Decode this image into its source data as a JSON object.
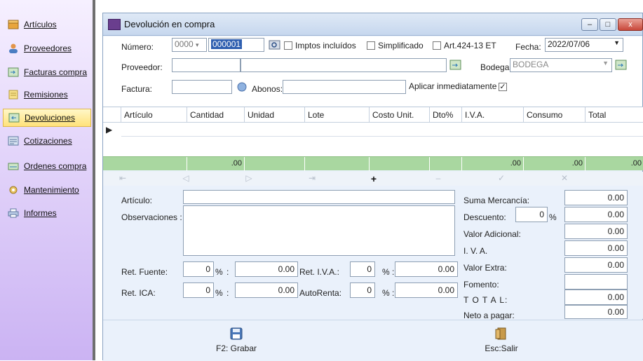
{
  "sidebar": {
    "items": [
      {
        "label": "Artículos",
        "icon": "box-icon"
      },
      {
        "label": "Proveedores",
        "icon": "user-icon"
      },
      {
        "label": "Facturas compra",
        "icon": "invoice-icon"
      },
      {
        "label": "Remisiones",
        "icon": "note-icon"
      },
      {
        "label": "Devoluciones",
        "icon": "return-icon"
      },
      {
        "label": "Cotizaciones",
        "icon": "quote-icon"
      },
      {
        "label": "Ordenes compra",
        "icon": "cart-icon"
      },
      {
        "label": "Mantenimiento",
        "icon": "gear-icon"
      },
      {
        "label": "Informes",
        "icon": "printer-icon"
      }
    ],
    "active": "Devoluciones"
  },
  "window": {
    "title": "Devolución en compra",
    "buttons": {
      "minimize": "–",
      "maximize": "□",
      "close": "x"
    }
  },
  "form": {
    "numero_label": "Número:",
    "numero_prefix": "0000",
    "numero_value": "000001",
    "imptos_label": "Imptos incluídos",
    "simplificado_label": "Simplificado",
    "art_label": "Art.424-13 ET",
    "fecha_label": "Fecha:",
    "fecha_value": "2022/07/06",
    "proveedor_label": "Proveedor:",
    "bodega_label": "Bodega:",
    "bodega_value": "BODEGA",
    "factura_label": "Factura:",
    "abonos_label": "Abonos:",
    "aplicar_label": "Aplicar inmediatamente",
    "aplicar_checked": "✓"
  },
  "grid": {
    "columns": [
      "Artículo",
      "Cantidad",
      "Unidad",
      "Lote",
      "Costo Unit.",
      "Dto%",
      "I.V.A.",
      "Consumo",
      "Total"
    ],
    "row_pointer": "▶",
    "totals": {
      "cantidad": ".00",
      "iva": ".00",
      "consumo": ".00",
      "total": ".00"
    }
  },
  "nav": {
    "buttons": [
      "first",
      "prev",
      "next",
      "last",
      "add",
      "delete",
      "edit",
      "cancel"
    ],
    "add_symbol": "+"
  },
  "bottom": {
    "articulo_label": "Artículo:",
    "observaciones_label": "Observaciones :",
    "ret_fuente_label": "Ret. Fuente:",
    "ret_fuente_pct": "0",
    "ret_fuente_val": "0.00",
    "ret_iva_label": "Ret. I.V.A.:",
    "ret_iva_pct": "0",
    "ret_iva_val": "0.00",
    "ret_ica_label": "Ret. ICA:",
    "ret_ica_pct": "0",
    "ret_ica_val": "0.00",
    "autorenta_label": "AutoRenta:",
    "autorenta_pct": "0",
    "autorenta_val": "0.00",
    "pct_symbol": "%",
    "colon": ":",
    "summary": {
      "suma_label": "Suma Mercancía:",
      "suma_val": "0.00",
      "descuento_label": "Descuento:",
      "descuento_pct": "0",
      "descuento_val": "0.00",
      "valor_adicional_label": "Valor Adicional:",
      "valor_adicional_val": "0.00",
      "iva_label": "I. V. A.",
      "iva_val": "0.00",
      "valor_extra_label": "Valor Extra:",
      "valor_extra_val": "0.00",
      "fomento_label": "Fomento:",
      "fomento_val": "",
      "total_label": "T O T A L:",
      "total_val": "0.00",
      "neto_label": "Neto a pagar:",
      "neto_val": "0.00"
    }
  },
  "footer": {
    "grabar_label": "F2: Grabar",
    "salir_label": "Esc:Salir"
  }
}
